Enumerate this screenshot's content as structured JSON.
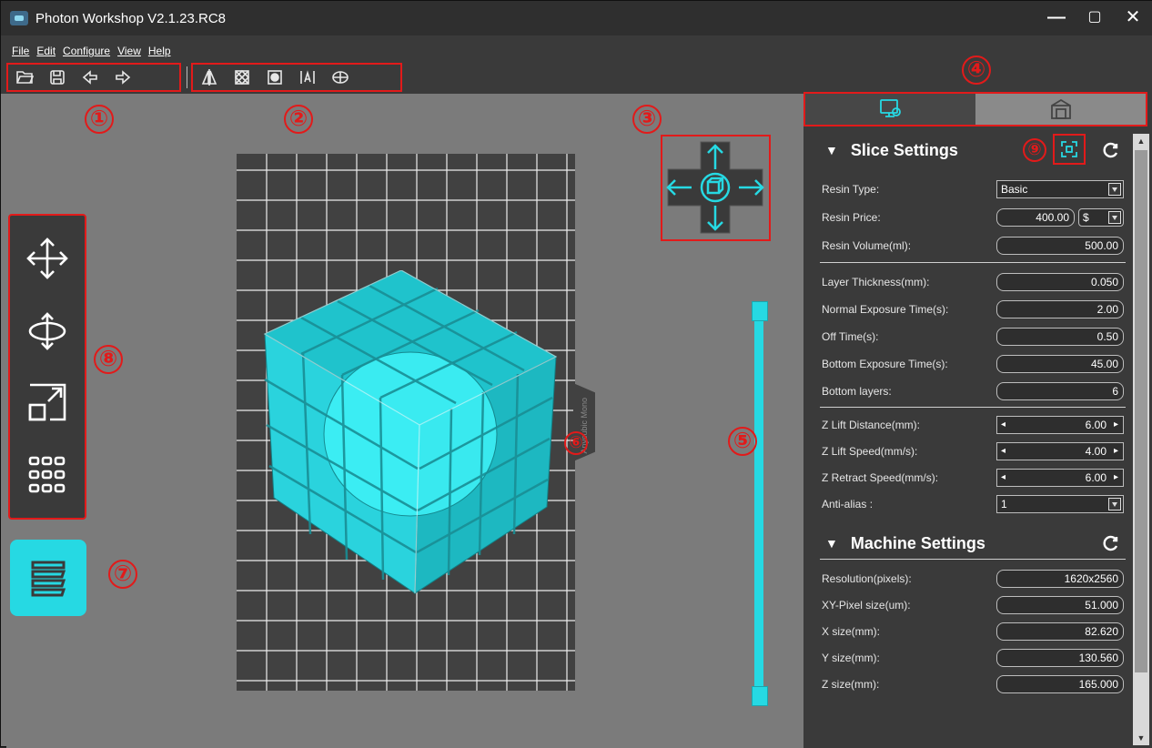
{
  "window": {
    "title": "Photon Workshop V2.1.23.RC8",
    "controls": [
      "minimize",
      "maximize",
      "close"
    ]
  },
  "menu": [
    "File",
    "Edit",
    "Configure",
    "View",
    "Help"
  ],
  "toolbar": {
    "file_group": [
      "open-icon",
      "save-icon",
      "undo-icon",
      "redo-icon"
    ],
    "tool_group": [
      "mirror-icon",
      "hollow-icon",
      "fill-icon",
      "text-icon",
      "supports-icon"
    ]
  },
  "markers": {
    "m1": "①",
    "m2": "②",
    "m3": "③",
    "m4": "④",
    "m5": "⑤",
    "m6": "⑥",
    "m7": "⑦",
    "m8": "⑧",
    "m9": "⑨"
  },
  "left_tools": [
    "move-icon",
    "rotate-icon",
    "scale-icon",
    "multiply-icon"
  ],
  "layer_button": "layers-icon",
  "plate_label": "Anycubic Mono",
  "panel_tabs": [
    "slice-settings-icon",
    "machine-icon"
  ],
  "slice_settings": {
    "title": "Slice Settings",
    "resin_type": {
      "label": "Resin Type:",
      "value": "Basic"
    },
    "resin_price": {
      "label": "Resin Price:",
      "value": "400.00",
      "currency": "$"
    },
    "resin_volume": {
      "label": "Resin Volume(ml):",
      "value": "500.00"
    },
    "layer_thickness": {
      "label": "Layer Thickness(mm):",
      "value": "0.050"
    },
    "normal_exposure": {
      "label": "Normal Exposure Time(s):",
      "value": "2.00"
    },
    "off_time": {
      "label": "Off Time(s):",
      "value": "0.50"
    },
    "bottom_exposure": {
      "label": "Bottom Exposure Time(s):",
      "value": "45.00"
    },
    "bottom_layers": {
      "label": "Bottom layers:",
      "value": "6"
    },
    "z_lift_distance": {
      "label": "Z Lift Distance(mm):",
      "value": "6.00"
    },
    "z_lift_speed": {
      "label": "Z Lift Speed(mm/s):",
      "value": "4.00"
    },
    "z_retract_speed": {
      "label": "Z Retract Speed(mm/s):",
      "value": "6.00"
    },
    "anti_alias": {
      "label": "Anti-alias :",
      "value": "1"
    }
  },
  "machine_settings": {
    "title": "Machine Settings",
    "resolution": {
      "label": "Resolution(pixels):",
      "value": "1620x2560"
    },
    "xy_pixel": {
      "label": "XY-Pixel size(um):",
      "value": "51.000"
    },
    "x_size": {
      "label": "X size(mm):",
      "value": "82.620"
    },
    "y_size": {
      "label": "Y size(mm):",
      "value": "130.560"
    },
    "z_size": {
      "label": "Z size(mm):",
      "value": "165.000"
    }
  },
  "colors": {
    "accent": "#26d9e3",
    "annotation": "#e21a1a",
    "panel": "#3a3a3a",
    "viewport": "#7b7b7b"
  }
}
